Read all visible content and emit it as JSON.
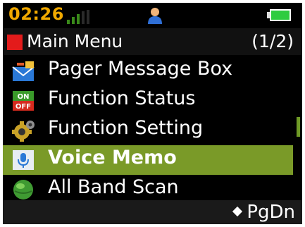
{
  "status": {
    "time": "02:26",
    "signal_icon": "signal-icon",
    "user_icon": "person-icon",
    "battery_icon": "battery-icon",
    "battery_color": "#2ecc40"
  },
  "header": {
    "title": "Main Menu",
    "page_indicator": "(1/2)",
    "accent": "#e31b1b"
  },
  "menu": {
    "items": [
      {
        "label": "Pager Message Box",
        "icon": "mail-icon",
        "selected": false
      },
      {
        "label": "Function Status",
        "icon": "on-off-icon",
        "selected": false
      },
      {
        "label": "Function Setting",
        "icon": "gear-icon",
        "selected": false
      },
      {
        "label": "Voice Memo",
        "icon": "microphone-icon",
        "selected": true
      },
      {
        "label": "All Band Scan",
        "icon": "globe-icon",
        "selected": false
      }
    ],
    "selected_color": "#7a9a28"
  },
  "footer": {
    "softkey": "PgDn"
  }
}
